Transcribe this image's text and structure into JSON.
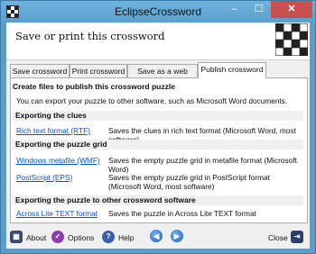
{
  "window": {
    "title": "EclipseCrossword",
    "min_glyph": "–",
    "max_glyph": "☐",
    "close_glyph": "✕"
  },
  "header": {
    "title": "Save or print this crossword"
  },
  "tabs": [
    {
      "label": "Save crossword",
      "active": false
    },
    {
      "label": "Print crossword",
      "active": false
    },
    {
      "label": "Save as a web page",
      "active": false
    },
    {
      "label": "Publish crossword",
      "active": true
    }
  ],
  "panel": {
    "heading": "Create files to publish this crossword puzzle",
    "intro": "You can export your puzzle to other software, such as Microsoft Word documents.",
    "sections": [
      {
        "title": "Exporting the clues",
        "items": [
          {
            "link": "Rich text format (RTF)",
            "desc": "Saves the clues in rich text format (Microsoft Word, most software)"
          }
        ]
      },
      {
        "title": "Exporting the puzzle grid",
        "items": [
          {
            "link": "Windows metafile (WMF)",
            "desc": "Saves the empty puzzle grid in metafile format (Microsoft Word)"
          },
          {
            "link": "PostScript (EPS)",
            "desc": "Saves the empty puzzle grid in PostScript format (Microsoft Word, most software)"
          }
        ]
      },
      {
        "title": "Exporting the puzzle to other crossword software",
        "items": [
          {
            "link": "Across Lite TEXT format",
            "desc": "Saves the puzzle in Across Lite TEXT format"
          }
        ]
      }
    ]
  },
  "bottombar": {
    "about": "About",
    "options": "Options",
    "help": "Help",
    "close": "Close",
    "back_glyph": "◀",
    "forward_glyph": "▶"
  },
  "colors": {
    "link": "#0a4fd6",
    "close_button": "#c75050",
    "titlebar": "#6fb2dd",
    "nav_icon": "#1b5fb8"
  }
}
